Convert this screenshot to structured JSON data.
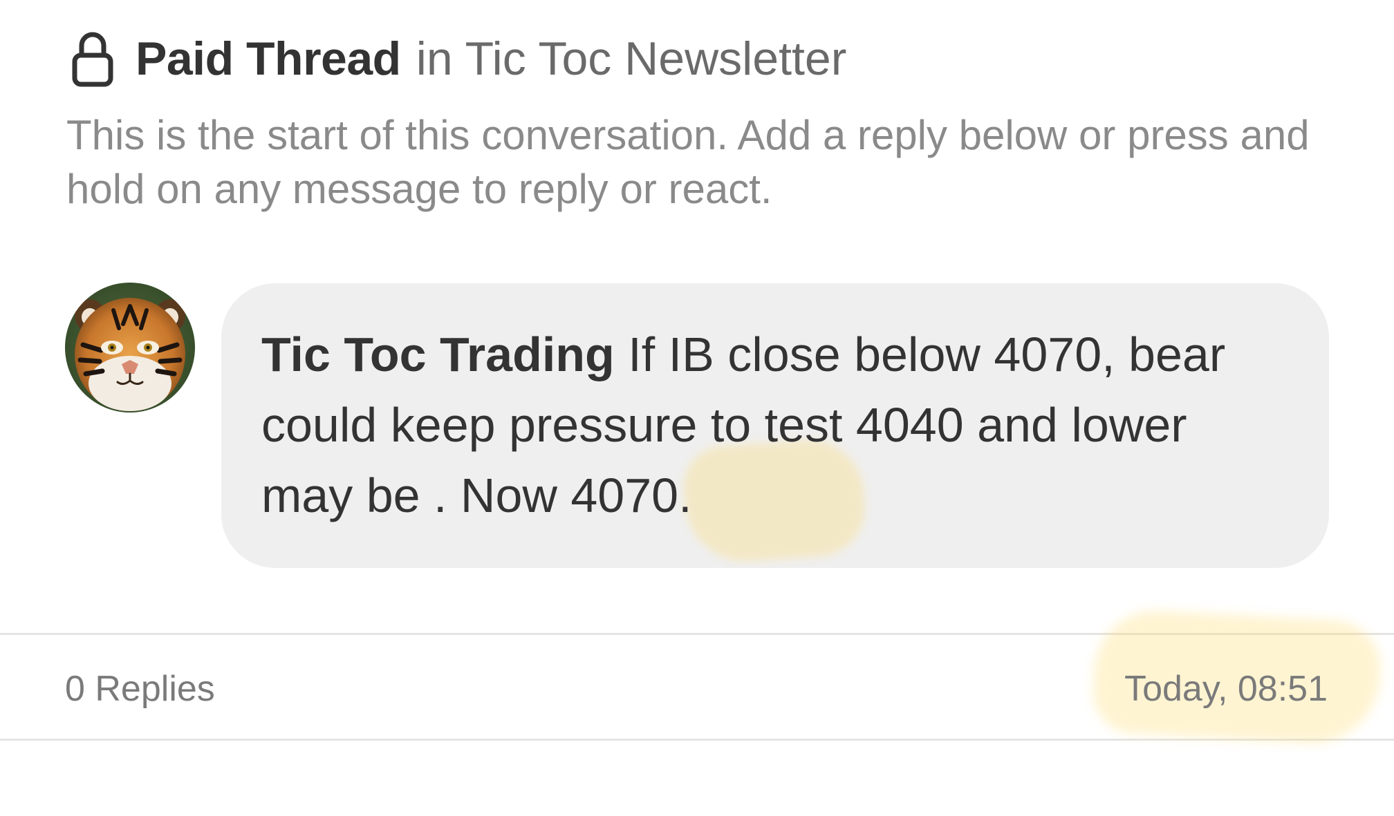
{
  "header": {
    "title": "Paid Thread",
    "in_word": "in",
    "newsletter_name": "Tic Toc Newsletter"
  },
  "intro_text": "This is the start of this conversation. Add a reply below or press and hold on any message to reply or react.",
  "message": {
    "sender": "Tic Toc Trading",
    "body": " If IB close below 4070, bear could keep pressure to test 4040 and lower may be . Now 4070."
  },
  "footer": {
    "replies": "0 Replies",
    "timestamp": "Today, 08:51"
  },
  "icons": {
    "lock": "lock-icon",
    "avatar": "tiger-avatar"
  },
  "colors": {
    "bubble_background": "#efefef",
    "highlight": "#ffd65e"
  }
}
